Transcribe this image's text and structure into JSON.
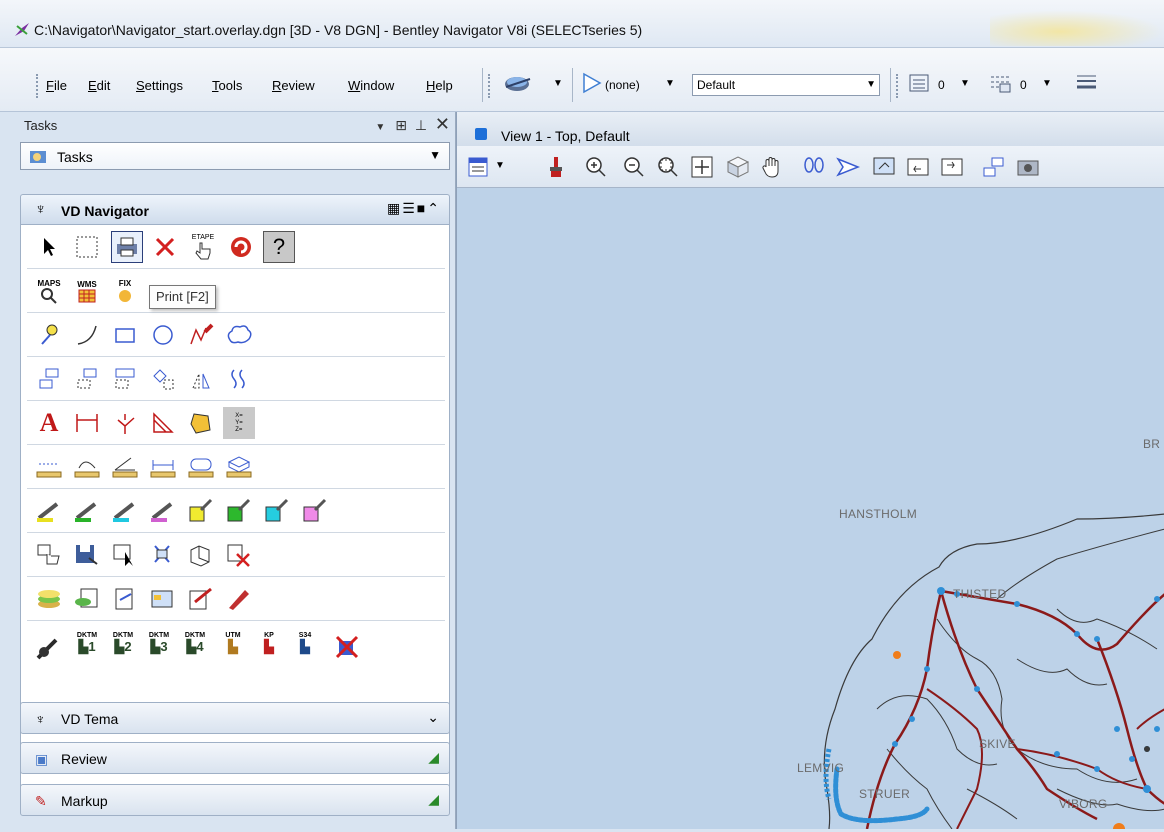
{
  "window": {
    "title": "C:\\Navigator\\Navigator_start.overlay.dgn [3D - V8 DGN] - Bentley Navigator V8i (SELECTseries 5)"
  },
  "menu": {
    "items": [
      {
        "label": "File",
        "u": "F",
        "rest": "ile"
      },
      {
        "label": "Edit",
        "u": "E",
        "rest": "dit"
      },
      {
        "label": "Settings",
        "u": "S",
        "rest": "ettings"
      },
      {
        "label": "Tools",
        "u": "T",
        "rest": "ools"
      },
      {
        "label": "Review",
        "u": "R",
        "rest": "eview"
      },
      {
        "label": "Window",
        "u": "W",
        "rest": "indow"
      },
      {
        "label": "Help",
        "u": "H",
        "rest": "elp"
      }
    ]
  },
  "toolbar": {
    "level_value": "(none)",
    "style_value": "Default",
    "weight_value": "0",
    "lines_value": "0"
  },
  "tasks_panel": {
    "header": "Tasks",
    "dropdown_value": "Tasks",
    "group_title": "VD Navigator",
    "tooltip": "Print [F2]",
    "collapsed_groups": [
      {
        "label": "VD Tema"
      },
      {
        "label": "Review"
      },
      {
        "label": "Markup"
      }
    ],
    "tool_text": {
      "etape": "ETAPE",
      "maps": "MAPS",
      "wms": "WMS",
      "fix": "FIX",
      "xyz": "X=\nY=\nZ=",
      "dktm1": "DKTM",
      "dktm2": "DKTM",
      "dktm3": "DKTM",
      "dktm4": "DKTM",
      "utm": "UTM",
      "kp": "KP",
      "s34": "S34"
    }
  },
  "view": {
    "title": "View 1 - Top, Default",
    "map_labels": {
      "hanstholm": "HANSTHOLM",
      "thisted": "THISTED",
      "skive": "SKIVE",
      "lemvig": "LEMVIG",
      "struer": "STRUER",
      "viborg": "VIBORG",
      "br": "BR"
    }
  },
  "colors": {
    "road": "#8b1a1a",
    "point": "#2f8fd6",
    "orange_point": "#f07d1a",
    "coast": "#3a3a3a",
    "map_bg": "#bdd2e8"
  }
}
